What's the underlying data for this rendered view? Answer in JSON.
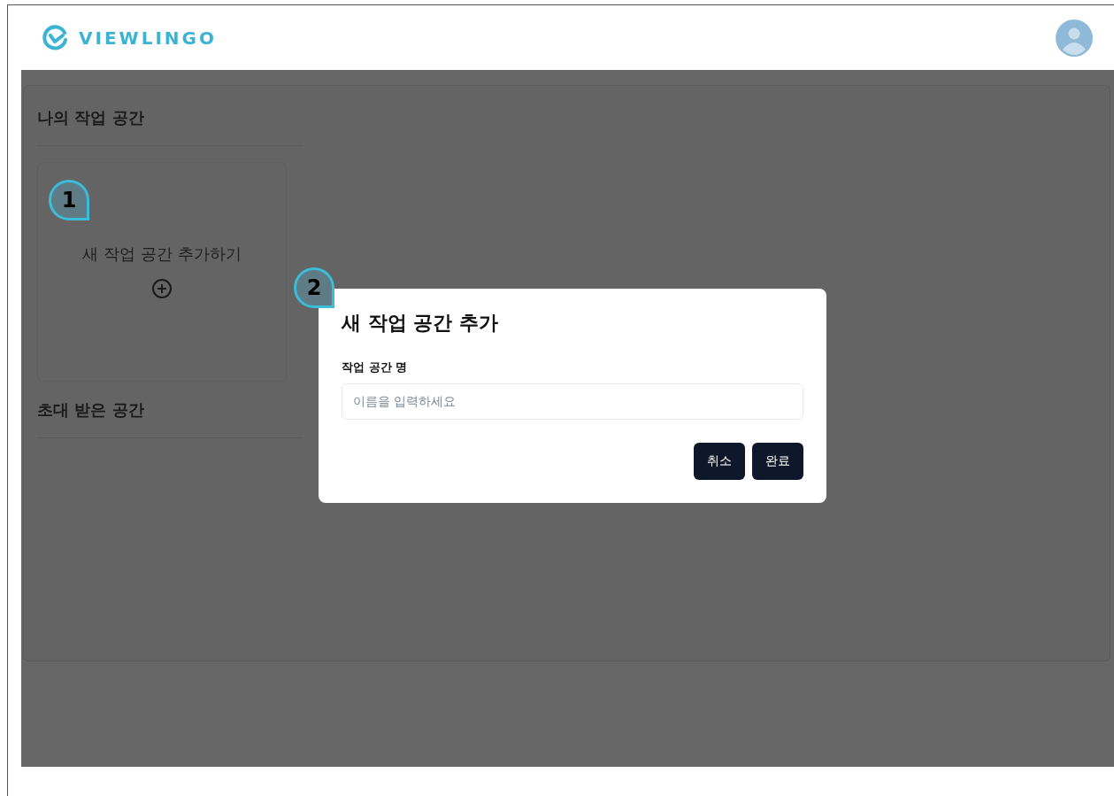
{
  "header": {
    "logo": "VIEWLINGO"
  },
  "sections": [
    {
      "title": "나의 작업 공간",
      "kind": "add",
      "card": {
        "label": "새 작업 공간 추가하기",
        "marker": "1"
      }
    },
    {
      "title": "초대 받은 공간",
      "kind": "empty"
    }
  ],
  "dialog": {
    "marker": "2",
    "title": "새 작업 공간 추가",
    "field_label": "작업 공간 명",
    "placeholder": "이름을 입력하세요",
    "buttons": [
      "취소",
      "완료"
    ]
  }
}
